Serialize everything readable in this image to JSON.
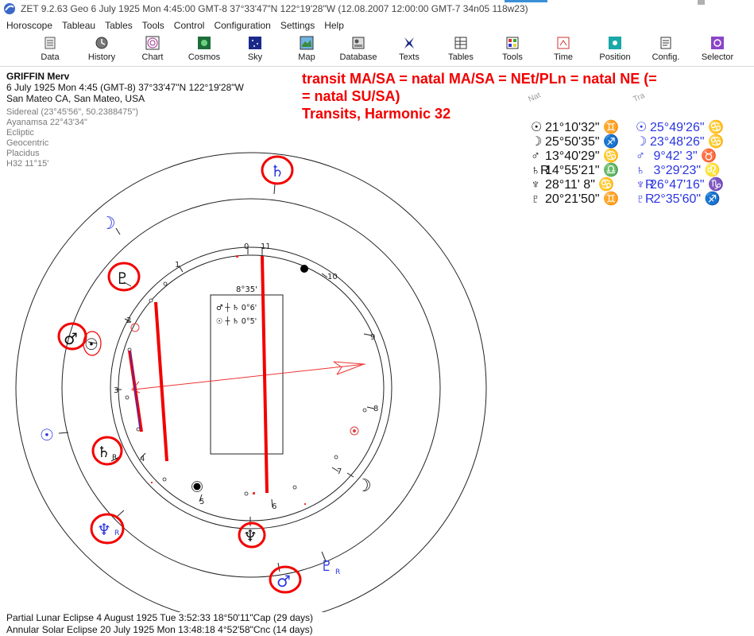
{
  "window": {
    "title": "ZET 9.2.63 Geo    6 July 1925  Mon   4:45:00 GMT-8 37°33'47\"N  122°19'28\"W   (12.08.2007  12:00:00 GMT-7 34n05 118w23)"
  },
  "menu": [
    "Horoscope",
    "Tableau",
    "Tables",
    "Tools",
    "Control",
    "Configuration",
    "Settings",
    "Help"
  ],
  "toolbar": [
    {
      "label": "Data",
      "icon": "data-icon"
    },
    {
      "label": "History",
      "icon": "history-icon"
    },
    {
      "label": "Chart",
      "icon": "chart-icon"
    },
    {
      "label": "Cosmos",
      "icon": "cosmos-icon"
    },
    {
      "label": "Sky",
      "icon": "sky-icon"
    },
    {
      "label": "Map",
      "icon": "map-icon"
    },
    {
      "label": "Database",
      "icon": "database-icon"
    },
    {
      "label": "Texts",
      "icon": "texts-icon"
    },
    {
      "label": "Tables",
      "icon": "tables-icon"
    },
    {
      "label": "Tools",
      "icon": "tools-icon"
    },
    {
      "label": "Time",
      "icon": "time-icon"
    },
    {
      "label": "Position",
      "icon": "position-icon"
    },
    {
      "label": "Config.",
      "icon": "config-icon"
    },
    {
      "label": "Selector",
      "icon": "selector-icon"
    }
  ],
  "info": {
    "name": "GRIFFIN Merv",
    "datetime": "6 July 1925  Mon    4:45 (GMT-8) 37°33'47\"N  122°19'28\"W",
    "place": "San Mateo CA, San Mateo, USA",
    "sidereal": "Sidereal (23°45'56\", 50.2388475\")",
    "ayanamsa": "Ayanamsa 22°43'34\"",
    "ecliptic": "Ecliptic",
    "geocentric": "Geocentric",
    "placidus": "Placidus",
    "harmonic": "H32  11°15'"
  },
  "annotation": {
    "line1": "transit MA/SA = natal MA/SA = NEt/PLn = natal NE (=",
    "line2": "= natal SU/SA)",
    "line3": "Transits, Harmonic 32"
  },
  "table": {
    "nat_header": "Nat",
    "tra_header": "Tra",
    "natal": [
      {
        "planet": "☉",
        "pos": "21°10'32\"",
        "sign": "♊"
      },
      {
        "planet": "☽",
        "pos": "25°50'35\"",
        "sign": "♐"
      },
      {
        "planet": "♂",
        "pos": "13°40'29\"",
        "sign": "♋"
      },
      {
        "planet": "♄R",
        "pos": "14°55'21\"",
        "sign": "♎"
      },
      {
        "planet": "♆",
        "pos": "28°11' 8\"",
        "sign": "♋"
      },
      {
        "planet": "♇",
        "pos": "20°21'50\"",
        "sign": "♊"
      }
    ],
    "transit": [
      {
        "planet": "☉",
        "pos": "25°49'26\"",
        "sign": "♋"
      },
      {
        "planet": "☽",
        "pos": "23°48'26\"",
        "sign": "♋"
      },
      {
        "planet": "♂",
        "pos": " 9°42' 3\"",
        "sign": "♉"
      },
      {
        "planet": "♄",
        "pos": " 3°29'23\"",
        "sign": "♌"
      },
      {
        "planet": "♆R",
        "pos": "26°47'16\"",
        "sign": "♑"
      },
      {
        "planet": "♇R",
        "pos": " 2°35'60\"",
        "sign": "♐"
      }
    ]
  },
  "wheel": {
    "midpoint_box": {
      "title": "8°35'",
      "row1": "♂ ┼ ♄   0°6'",
      "row2": "☉ ┼ ♄   0°5'"
    },
    "house_numbers": [
      "0",
      "11",
      "10",
      "9",
      "8",
      "7",
      "6",
      "5",
      "4",
      "3",
      "2",
      "1"
    ],
    "glyphs": {
      "sat_tr": "♄",
      "moon_outer": "☽",
      "pluto_na": "♇",
      "mars_na": "♂",
      "sun_na": "☉",
      "sun_outer": "☉",
      "sat_na": "♄",
      "sat_na_sub": "R",
      "nep_outer": "♆",
      "nep_outer_sub": "R",
      "nep_na": "♆",
      "mars_tr": "♂",
      "pluto_outer": "♇",
      "pluto_outer_sub": "R",
      "moon_na": "☽"
    }
  },
  "colors": {
    "accent": "#f20000",
    "transit": "#2a35e0",
    "natal": "#111111"
  },
  "footer": {
    "line1": "Partial Lunar Eclipse 4 August 1925 Tue  3:52:33 18°50'11\"Cap (29 days)",
    "line2": "Annular Solar Eclipse 20 July 1925 Mon 13:48:18  4°52'58\"Cnc (14 days)"
  }
}
